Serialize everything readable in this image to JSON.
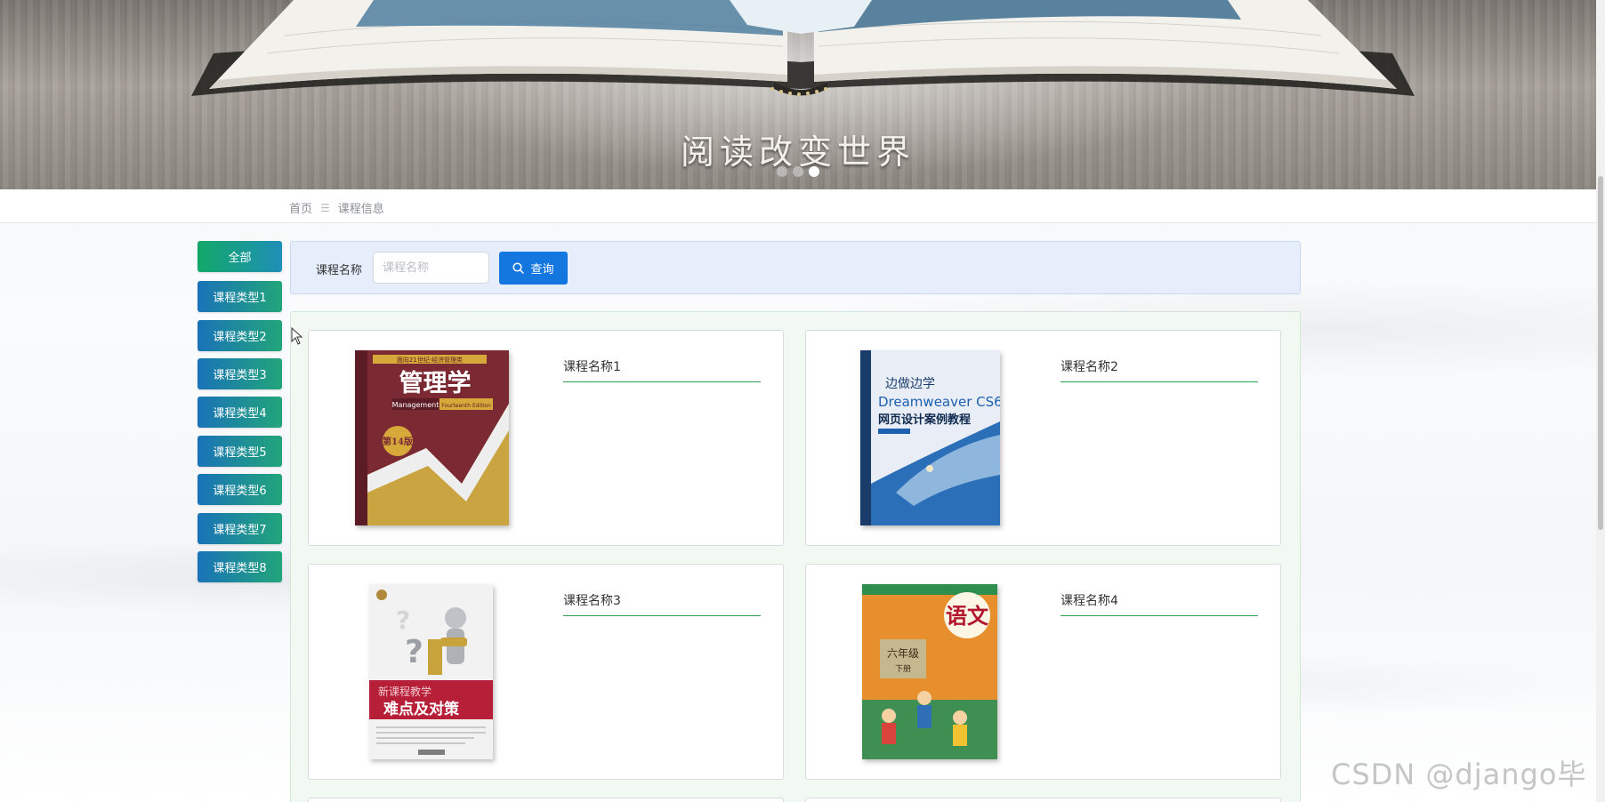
{
  "banner": {
    "caption": "阅读改变世界",
    "slide_count": 3,
    "active_slide": 3
  },
  "breadcrumb": {
    "home": "首页",
    "separator": "☰",
    "current": "课程信息"
  },
  "sidebar": {
    "items": [
      {
        "label": "全部",
        "active": true
      },
      {
        "label": "课程类型1"
      },
      {
        "label": "课程类型2"
      },
      {
        "label": "课程类型3"
      },
      {
        "label": "课程类型4"
      },
      {
        "label": "课程类型5"
      },
      {
        "label": "课程类型6"
      },
      {
        "label": "课程类型7"
      },
      {
        "label": "课程类型8"
      }
    ]
  },
  "search": {
    "label": "课程名称",
    "placeholder": "课程名称",
    "value": "",
    "button_label": "查询"
  },
  "courses": [
    {
      "title": "课程名称1",
      "cover": {
        "series": "面向21世纪·经济管理类",
        "title": "管理学",
        "edition_label": "Management",
        "edition_sub": "Fourteenth Edition",
        "badge": "第14版",
        "colors": {
          "bg": "#7b2a34",
          "accent": "#d7a83a"
        }
      }
    },
    {
      "title": "课程名称2",
      "cover": {
        "series": "边做边学",
        "title": "Dreamweaver CS6",
        "subtitle": "网页设计案例教程",
        "colors": {
          "bg": "#e9eef6",
          "accent": "#1d5fb0"
        }
      }
    },
    {
      "title": "课程名称3",
      "cover": {
        "title": "新课程教学",
        "subtitle": "难点及对策",
        "colors": {
          "bg": "#f2f2f2",
          "accent": "#b61f37"
        }
      }
    },
    {
      "title": "课程名称4",
      "cover": {
        "title": "语文",
        "subtitle": "六年级",
        "sub2": "下册",
        "colors": {
          "bg": "#e88f2d",
          "accent": "#2e8f4c"
        }
      }
    }
  ],
  "watermark": "CSDN @django毕设",
  "colors": {
    "primary": "#1477e0",
    "green_line": "#2e9e57",
    "sidebar_gradient_start": "#1a73b8",
    "sidebar_gradient_end": "#22a57a"
  }
}
